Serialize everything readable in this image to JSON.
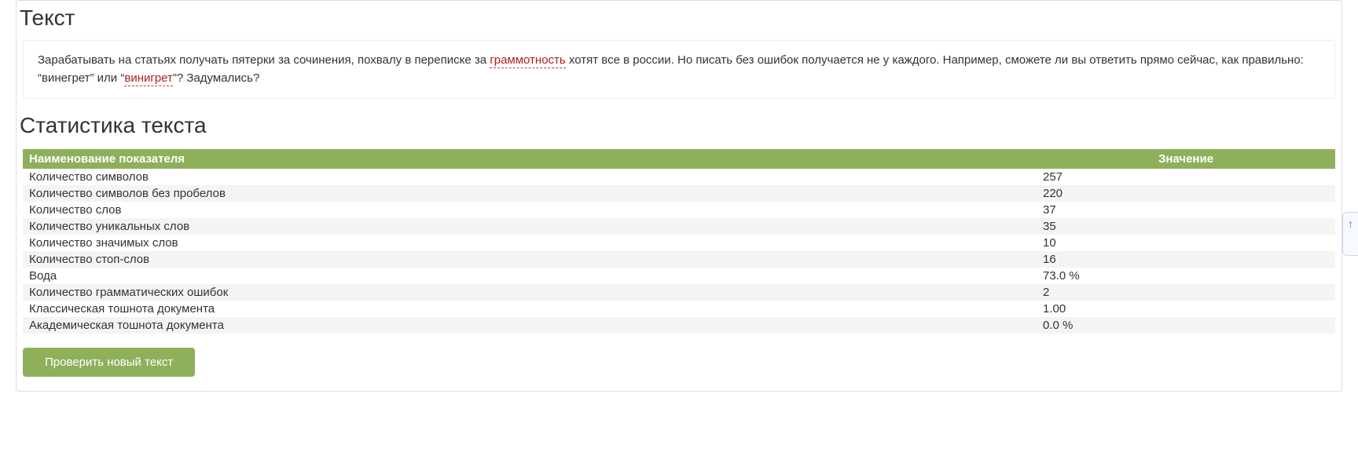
{
  "headings": {
    "text": "Текст",
    "stats": "Статистика текста"
  },
  "sample_text": {
    "part1": "Зарабатывать на статьях получать пятерки за сочинения, похвалу в переписке за ",
    "err1": "граммотность",
    "part2": " хотят все в россии. Но писать без ошибок получается не у каждого. Например, сможете ли вы ответить прямо сейчас, как правильно: “винегрет” или “",
    "err2": "винигрет",
    "part3": "”? Задумались?"
  },
  "table": {
    "header_name": "Наименование показателя",
    "header_value": "Значение",
    "rows": [
      {
        "name": "Количество символов",
        "value": "257"
      },
      {
        "name": "Количество символов без пробелов",
        "value": "220"
      },
      {
        "name": "Количество слов",
        "value": "37"
      },
      {
        "name": "Количество уникальных слов",
        "value": "35"
      },
      {
        "name": "Количество значимых слов",
        "value": "10"
      },
      {
        "name": "Количество стоп-слов",
        "value": "16"
      },
      {
        "name": "Вода",
        "value": "73.0 %"
      },
      {
        "name": "Количество грамматических ошибок",
        "value": "2"
      },
      {
        "name": "Классическая тошнота документа",
        "value": "1.00"
      },
      {
        "name": "Академическая тошнота документа",
        "value": "0.0 %"
      }
    ]
  },
  "button": {
    "check_new": "Проверить новый текст"
  },
  "scroll_hint": "↑"
}
